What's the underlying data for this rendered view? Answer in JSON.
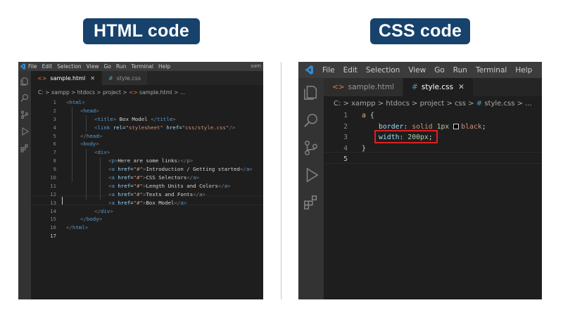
{
  "titles": {
    "left": "HTML code",
    "right": "CSS code"
  },
  "colors": {
    "badge_bg": "#17426c",
    "editor_bg": "#1e1e1e",
    "highlight": "#e02020"
  },
  "left_editor": {
    "menu": [
      "File",
      "Edit",
      "Selection",
      "View",
      "Go",
      "Run",
      "Terminal",
      "Help"
    ],
    "user": "sam",
    "tabs": [
      {
        "icon": "<>",
        "label": "sample.html",
        "close": "✕",
        "active": true
      },
      {
        "icon": "#",
        "label": "style.css",
        "active": false
      }
    ],
    "breadcrumb": [
      "C:",
      ">",
      "xampp",
      ">",
      "htdocs",
      ">",
      "project",
      ">",
      "<>",
      "sample.html",
      ">",
      "..."
    ],
    "line_numbers": [
      "1",
      "2",
      "3",
      "4",
      "5",
      "6",
      "7",
      "8",
      "9",
      "10",
      "11",
      "12",
      "13",
      "14",
      "15",
      "16",
      "17"
    ],
    "lines": [
      {
        "t": "<",
        "b": "html",
        ">": ">"
      },
      {
        "t": "head"
      },
      {
        "title_open": "title",
        "text": " Box Model ",
        "title_close": "title"
      },
      {
        "tag": "link",
        "a1": "rel",
        "v1": "\"stylesheet\"",
        "a2": "href",
        "v2": "\"css/style.css\""
      },
      {
        "t": "head"
      },
      {
        "t": "body"
      },
      {
        "t": "div"
      },
      {
        "tag": "p",
        "text": "Here are some links:"
      },
      {
        "attr": "href",
        "val": "\"#\"",
        "text": "Introduction / Getting started"
      },
      {
        "attr": "href",
        "val": "\"#\"",
        "text": "CSS Selectors"
      },
      {
        "attr": "href",
        "val": "\"#\"",
        "text": "Length Units and Colors"
      },
      {
        "attr": "href",
        "val": "\"#\"",
        "text": "Texts and Fonts"
      },
      {
        "attr": "href",
        "val": "\"#\"",
        "text": "Box Model"
      },
      {
        "t": "div"
      },
      {
        "t": "body"
      },
      {
        "t": "html"
      },
      {
        "t": ""
      }
    ]
  },
  "right_editor": {
    "menu": [
      "File",
      "Edit",
      "Selection",
      "View",
      "Go",
      "Run",
      "Terminal",
      "Help"
    ],
    "tabs": [
      {
        "icon": "<>",
        "label": "sample.html",
        "active": false
      },
      {
        "icon": "#",
        "label": "style.css",
        "close": "✕",
        "active": true
      }
    ],
    "breadcrumb": [
      "C:",
      ">",
      "xampp",
      ">",
      "htdocs",
      ">",
      "project",
      ">",
      "css",
      ">",
      "#",
      "style.css",
      ">",
      "..."
    ],
    "line_numbers": [
      "1",
      "2",
      "3",
      "4",
      "5"
    ],
    "code": {
      "selector": "a",
      "open_brace": "{",
      "prop1": "border",
      "val1a": "solid",
      "val1b": "1px",
      "val1c": "black",
      "prop2": "width",
      "val2": "200px",
      "close_brace": "}"
    }
  }
}
